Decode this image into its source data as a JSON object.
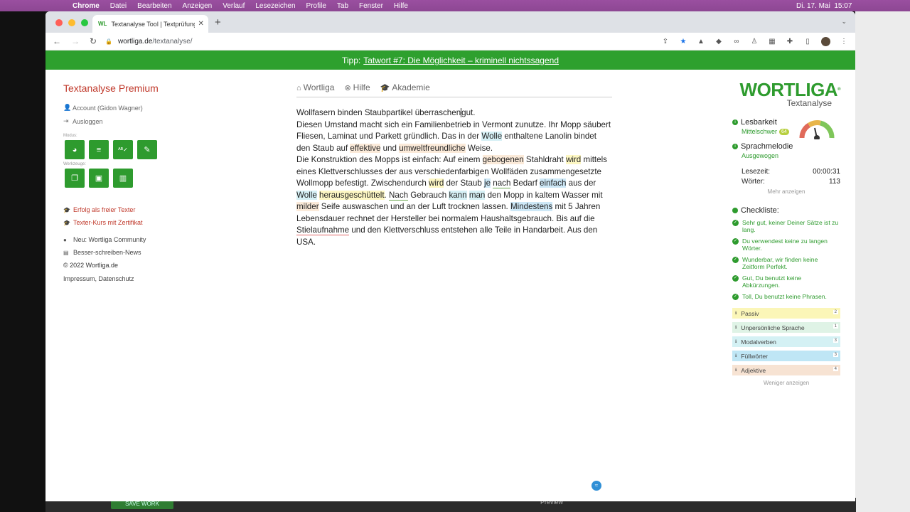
{
  "menubar": {
    "items": [
      "Chrome",
      "Datei",
      "Bearbeiten",
      "Anzeigen",
      "Verlauf",
      "Lesezeichen",
      "Profile",
      "Tab",
      "Fenster",
      "Hilfe"
    ],
    "clock": "Di. 17. Mai  15:07"
  },
  "browser": {
    "tab_title": "Textanalyse Tool | Textprüfung",
    "tab_favicon": "WL",
    "url_host": "wortliga.de",
    "url_path": "/textanalyse/"
  },
  "tip": {
    "prefix": "Tipp:",
    "link": "Tatwort #7: Die Möglichkeit – kriminell nichtssagend"
  },
  "sidebar": {
    "brand": "Textanalyse Premium",
    "account": "Account (Gidon Wagner)",
    "logout": "Ausloggen",
    "mode_label": "Modus:",
    "tools_label": "Werkzeuge:",
    "links_red": [
      "Erfolg als freier Texter",
      "Texter-Kurs mit Zertifikat"
    ],
    "links_gray": [
      "Neu: Wortliga Community",
      "Besser-schreiben-News"
    ],
    "copyright": "© 2022 Wortliga.de",
    "impressum": "Impressum",
    "datenschutz": "Datenschutz"
  },
  "topnav": [
    "Wortliga",
    "Hilfe",
    "Akademie"
  ],
  "editor": {
    "l1": "Wollfasern binden Staubpartikel überraschen",
    "l1b": "gut.",
    "p2a": "Diesen Umstand macht sich ein Familienbetrieb in Vermont zunutze. Ihr Mopp säubert Fliesen, Laminat und Parkett gründlich. Das in der ",
    "wolle1": "Wolle",
    "p2b": " enthaltene Lanolin bindet den Staub auf ",
    "effektive": "effektive",
    "und1": " und ",
    "umwelt": "umweltfreundliche",
    "p2c": " Weise.",
    "p3a": "Die Konstruktion des Mopps ist einfach: Auf einem ",
    "gebogenen": "gebogenen",
    "p3b": " Stahldraht ",
    "wird1": "wird",
    "p3c": " mittels eines Klettverschlusses der aus verschiedenfarbigen Wollfäden zusammengesetzte Wollmopp befestigt. Zwischendurch ",
    "wird2": "wird",
    "p3d": " der Staub ",
    "je": "je",
    "sp1": " ",
    "nach1": "nach",
    "p3e": " Bedarf ",
    "einfach": "einfach",
    "p3f": " aus der ",
    "wolle2": "Wolle",
    "sp2": " ",
    "heraus": "herausgeschüttelt",
    "p3g": ". ",
    "nach2": "Nach",
    "p3h": " Gebrauch ",
    "kann": "kann",
    "sp3": " ",
    "man": "man",
    "p3i": " den Mopp in kaltem Wasser mit ",
    "milder": "milder",
    "p3j": " Seife auswaschen und an der Luft trocknen lassen. ",
    "mindestens": "Mindestens",
    "p3k": " mit 5 Jahren Lebensdauer rechnet der Hersteller bei normalem Haushaltsgebrauch. Bis auf die ",
    "stiel": "Stielaufnahme",
    "p3l": " und den Klettverschluss entstehen alle Teile in Handarbeit. Aus den USA."
  },
  "panel": {
    "logo": "WORTLIGA",
    "logo_sub": "Textanalyse",
    "readability_label": "Lesbarkeit",
    "readability_value": "Mittelschwer",
    "readability_score": "64",
    "melody_label": "Sprachmelodie",
    "melody_value": "Ausgewogen",
    "reading_time_label": "Lesezeit:",
    "reading_time": "00:00:31",
    "words_label": "Wörter:",
    "words": "113",
    "more": "Mehr anzeigen",
    "checklist_label": "Checkliste:",
    "checks": [
      "Sehr gut, keiner Deiner Sätze ist zu lang.",
      "Du verwendest keine zu langen Wörter.",
      "Wunderbar, wir finden keine Zeitform Perfekt.",
      "Gut, Du benutzt keine Abkürzungen.",
      "Toll, Du benutzt keine Phrasen."
    ],
    "categories": [
      {
        "label": "Passiv",
        "count": "2",
        "color": "#fbf6b8"
      },
      {
        "label": "Unpersönliche Sprache",
        "count": "1",
        "color": "#dff3e6"
      },
      {
        "label": "Modalverben",
        "count": "3",
        "color": "#d4f1f4"
      },
      {
        "label": "Füllwörter",
        "count": "3",
        "color": "#bfe6f5"
      },
      {
        "label": "Adjektive",
        "count": "4",
        "color": "#f7e3d3"
      }
    ],
    "less": "Weniger anzeigen"
  },
  "background": {
    "save_label": "SAVE WORK",
    "preview_label": "Preview"
  }
}
